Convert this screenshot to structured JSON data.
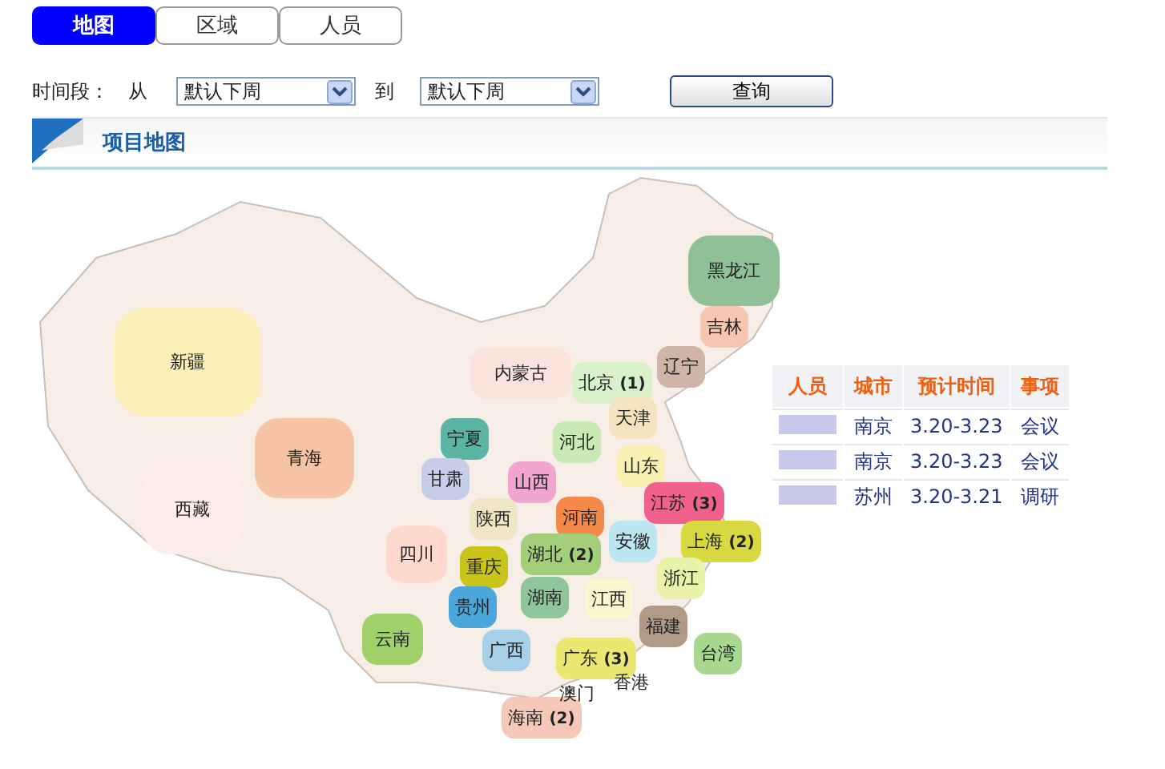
{
  "tabs": [
    {
      "label": "地图",
      "selected": true
    },
    {
      "label": "区域",
      "selected": false
    },
    {
      "label": "人员",
      "selected": false
    }
  ],
  "filter": {
    "label": "时间段：",
    "from_label": "从",
    "from_value": "默认下周",
    "to_label": "到",
    "to_value": "默认下周",
    "button": "查询"
  },
  "section": {
    "title": "项目地图"
  },
  "map": {
    "provinces": [
      {
        "name": "新疆",
        "color": "#fbf0b8"
      },
      {
        "name": "西藏",
        "color": "#fdecec"
      },
      {
        "name": "青海",
        "color": "#f6c3a5"
      },
      {
        "name": "内蒙古",
        "color": "#fbe3dd"
      },
      {
        "name": "黑龙江",
        "color": "#8fc098"
      },
      {
        "name": "吉林",
        "color": "#f7c6b0"
      },
      {
        "name": "辽宁",
        "color": "#cfb4a8"
      },
      {
        "name": "北京 **(1)**",
        "color": "#d9f0c9"
      },
      {
        "name": "天津",
        "color": "#f5e3c0"
      },
      {
        "name": "河北",
        "color": "#c9eab4"
      },
      {
        "name": "山西",
        "color": "#f2a6cf"
      },
      {
        "name": "山东",
        "color": "#f7f0b0"
      },
      {
        "name": "宁夏",
        "color": "#5ab5a5"
      },
      {
        "name": "甘肃",
        "color": "#c5cde8"
      },
      {
        "name": "陕西",
        "color": "#efe6c6"
      },
      {
        "name": "河南",
        "color": "#f4894a"
      },
      {
        "name": "江苏 **(3)**",
        "color": "#f0628d"
      },
      {
        "name": "安徽",
        "color": "#bce6f2"
      },
      {
        "name": "上海 **(2)**",
        "color": "#d8d840"
      },
      {
        "name": "湖北 **(2)**",
        "color": "#a3cf7a"
      },
      {
        "name": "四川",
        "color": "#fcd9cc"
      },
      {
        "name": "重庆",
        "color": "#c9c41a"
      },
      {
        "name": "浙江",
        "color": "#e8f2a8"
      },
      {
        "name": "贵州",
        "color": "#4ba6dc"
      },
      {
        "name": "湖南",
        "color": "#8fc59a"
      },
      {
        "name": "江西",
        "color": "#fcf6d0"
      },
      {
        "name": "福建",
        "color": "#b09a86"
      },
      {
        "name": "云南",
        "color": "#9fd06a"
      },
      {
        "name": "广西",
        "color": "#a6cfea"
      },
      {
        "name": "广东 **(3)**",
        "color": "#eae870"
      },
      {
        "name": "台湾",
        "color": "#a8d890"
      },
      {
        "name": "香港"
      },
      {
        "name": "澳门"
      },
      {
        "name": "海南 **(2)**",
        "color": "#f6c8b8"
      }
    ]
  },
  "table": {
    "columns": [
      "人员",
      "城市",
      "预计时间",
      "事项"
    ],
    "rows": [
      {
        "city": "南京",
        "time": "3.20-3.23",
        "item": "会议"
      },
      {
        "city": "南京",
        "time": "3.20-3.23",
        "item": "会议"
      },
      {
        "city": "苏州",
        "time": "3.20-3.21",
        "item": "调研"
      }
    ]
  }
}
